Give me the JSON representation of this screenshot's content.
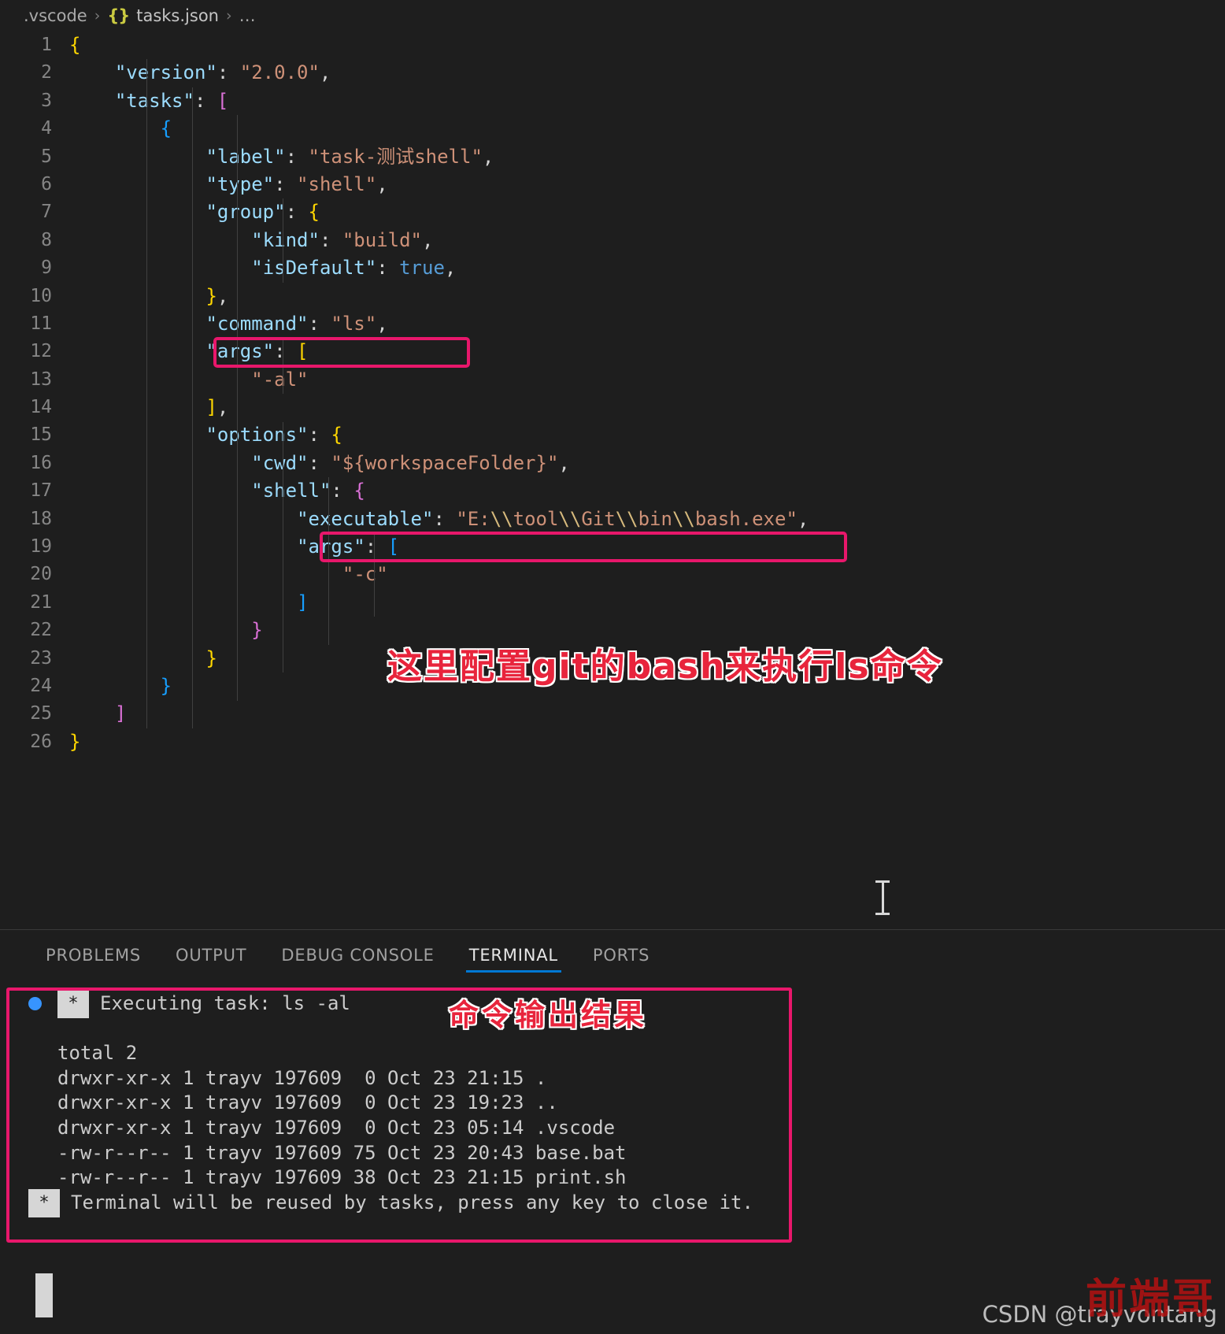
{
  "breadcrumb": {
    "folder": ".vscode",
    "sep": "›",
    "json_icon": "{}",
    "file": "tasks.json",
    "dots": "…"
  },
  "editor": {
    "language": "json",
    "lines": [
      {
        "n": "1",
        "text": "{"
      },
      {
        "n": "2",
        "text": "    \"version\": \"2.0.0\","
      },
      {
        "n": "3",
        "text": "    \"tasks\": ["
      },
      {
        "n": "4",
        "text": "        {"
      },
      {
        "n": "5",
        "text": "            \"label\": \"task-测试shell\","
      },
      {
        "n": "6",
        "text": "            \"type\": \"shell\","
      },
      {
        "n": "7",
        "text": "            \"group\": {"
      },
      {
        "n": "8",
        "text": "                \"kind\": \"build\","
      },
      {
        "n": "9",
        "text": "                \"isDefault\": true,"
      },
      {
        "n": "10",
        "text": "            },"
      },
      {
        "n": "11",
        "text": "            \"command\": \"ls\","
      },
      {
        "n": "12",
        "text": "            \"args\": ["
      },
      {
        "n": "13",
        "text": "                \"-al\""
      },
      {
        "n": "14",
        "text": "            ],"
      },
      {
        "n": "15",
        "text": "            \"options\": {"
      },
      {
        "n": "16",
        "text": "                \"cwd\": \"${workspaceFolder}\","
      },
      {
        "n": "17",
        "text": "                \"shell\": {"
      },
      {
        "n": "18",
        "text": "                    \"executable\": \"E:\\\\tool\\\\Git\\\\bin\\\\bash.exe\","
      },
      {
        "n": "19",
        "text": "                    \"args\": ["
      },
      {
        "n": "20",
        "text": "                        \"-c\""
      },
      {
        "n": "21",
        "text": "                    ]"
      },
      {
        "n": "22",
        "text": "                }"
      },
      {
        "n": "23",
        "text": "            }"
      },
      {
        "n": "24",
        "text": "        }"
      },
      {
        "n": "25",
        "text": "    ]"
      },
      {
        "n": "26",
        "text": "}"
      }
    ],
    "annotation": "这里配置git的bash来执行ls命令",
    "highlight_color": "#e8176b",
    "annotation_color": "#e8243c"
  },
  "panel": {
    "tabs": [
      {
        "label": "PROBLEMS",
        "active": false
      },
      {
        "label": "OUTPUT",
        "active": false
      },
      {
        "label": "DEBUG CONSOLE",
        "active": false
      },
      {
        "label": "TERMINAL",
        "active": true
      },
      {
        "label": "PORTS",
        "active": false
      }
    ],
    "active_tab": "TERMINAL",
    "active_underline_color": "#0078d4"
  },
  "terminal": {
    "star": "*",
    "executing_line": "Executing task: ls -al",
    "lines": [
      "total 2",
      "drwxr-xr-x 1 trayv 197609  0 Oct 23 21:15 .",
      "drwxr-xr-x 1 trayv 197609  0 Oct 23 19:23 ..",
      "drwxr-xr-x 1 trayv 197609  0 Oct 23 05:14 .vscode",
      "-rw-r--r-- 1 trayv 197609 75 Oct 23 20:43 base.bat",
      "-rw-r--r-- 1 trayv 197609 38 Oct 23 21:15 print.sh"
    ],
    "reuse_line": "Terminal will be reused by tasks, press any key to close it.",
    "annotation": "命令输出结果",
    "highlight_color": "#e8176b"
  },
  "watermark": {
    "csdn": "CSDN @trayvontang",
    "chinese": "前端哥"
  }
}
